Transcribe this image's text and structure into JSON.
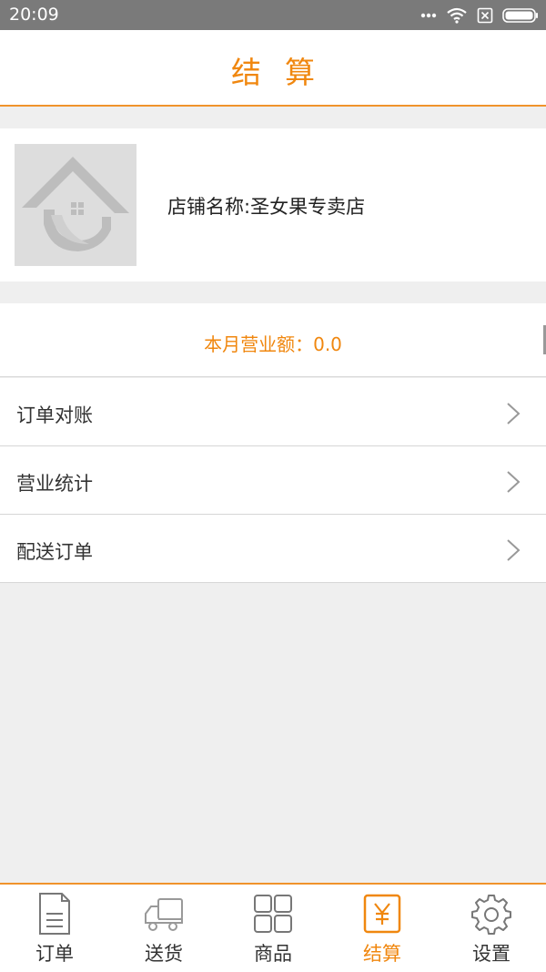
{
  "status_bar": {
    "time": "20:09"
  },
  "header": {
    "title": "结算"
  },
  "store": {
    "name": "店铺名称:圣女果专卖店"
  },
  "revenue": {
    "text": "本月营业额：0.0"
  },
  "menu": {
    "items": [
      {
        "label": "订单对账"
      },
      {
        "label": "营业统计"
      },
      {
        "label": "配送订单"
      }
    ]
  },
  "tabs": {
    "items": [
      {
        "label": "订单",
        "icon": "document-icon"
      },
      {
        "label": "送货",
        "icon": "truck-icon"
      },
      {
        "label": "商品",
        "icon": "grid-icon"
      },
      {
        "label": "结算",
        "icon": "yen-icon",
        "active": true
      },
      {
        "label": "设置",
        "icon": "gear-icon"
      }
    ]
  },
  "colors": {
    "accent": "#f0870f",
    "status_bar": "#7a7a7a",
    "background": "#efefef"
  }
}
